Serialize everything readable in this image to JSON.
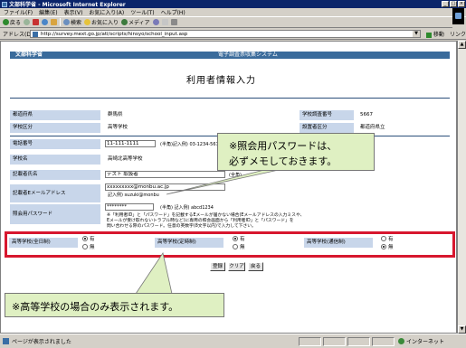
{
  "window": {
    "title": "文部科学省 - Microsoft Internet Explorer",
    "buttons": [
      "_",
      "□",
      "×"
    ]
  },
  "menu": [
    "ファイル(F)",
    "編集(E)",
    "表示(V)",
    "お気に入り(A)",
    "ツール(T)",
    "ヘルプ(H)"
  ],
  "toolbar": {
    "back": "戻る",
    "search": "検索",
    "favorites": "お気に入り",
    "media": "メディア"
  },
  "address": {
    "label": "アドレス(D)",
    "url": "http://survey.mext.go.jp/ati/scripts/hinsyo/school_input.asp",
    "go": "移動",
    "links": "リンク"
  },
  "page": {
    "ministry": "文部科学省",
    "system": "電子調査票収集システム",
    "title": "利用者情報入力",
    "prefecture_label": "都道府県",
    "prefecture_value": "群馬県",
    "school_code_label": "学校調査番号",
    "school_code_value": "5667",
    "school_type_label": "学校区分",
    "school_type_value": "高等学校",
    "founder_label": "設置者区分",
    "founder_value": "都道府県立",
    "phone_label": "電話番号",
    "phone_value": "11-111-1111",
    "phone_hint": "(半角)記入例) 03-1234-5678",
    "school_name_label": "学校名",
    "school_name_value": "高崎北高等学校",
    "person_label": "記載者氏名",
    "person_value": "テスト 取扱者",
    "person_hint": "(全角)",
    "email_label": "記載者Eメールアドレス",
    "email_value": "xxxxxxxxx@monbu.ac.jp",
    "email_value2": "xxxxxxxxx@monbu",
    "email_hint": "記入例) suzuki@monbu",
    "password_label": "照会用パスワード",
    "password_value": "********",
    "password_hint": "(半角) 記入例) abcd1234",
    "note_line1": "※「利用者ID」と「パスワード」を記載するEメールが届かない場合(Eメールアドレスの入力ミスや、",
    "note_line2": "Eメールが受け取れないトラブル時など)に専用の照会画面から「利用者ID」と「パスワード」を",
    "note_line3": "問い合わせる際のパスワード。任意の英数字(8文字以内)で入力して下さい。"
  },
  "high_school": {
    "fulltime_label": "高等学校(全日制)",
    "parttime_label": "高等学校(定時制)",
    "correspondence_label": "高等学校(通信制)",
    "yes": "有",
    "no": "無",
    "fulltime_selected": "有",
    "parttime_selected": "有",
    "correspondence_selected": "無"
  },
  "buttons": {
    "register": "登録",
    "clear": "クリア",
    "back": "戻る"
  },
  "callouts": {
    "password_line1": "※照会用パスワードは、",
    "password_line2": "必ずメモしておきます。",
    "high_school": "※高等学校の場合のみ表示されます。"
  },
  "status": {
    "text": "ページが表示されました",
    "zone": "インターネット"
  },
  "colors": {
    "title_bar": "#0a246a",
    "header_band": "#3a6b9b",
    "label_bg": "#c8d6ea",
    "highlight_border": "#d7172e",
    "callout_bg": "#dff0c2"
  }
}
